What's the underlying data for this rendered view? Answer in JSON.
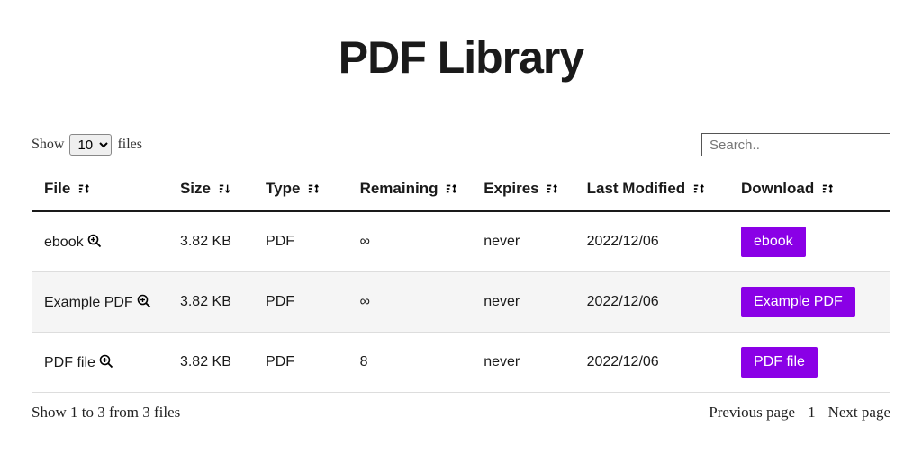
{
  "title": "PDF Library",
  "controls": {
    "show_prefix": "Show",
    "show_value": "10",
    "show_suffix": "files",
    "search_placeholder": "Search.."
  },
  "columns": {
    "file": "File",
    "size": "Size",
    "type": "Type",
    "remaining": "Remaining",
    "expires": "Expires",
    "modified": "Last Modified",
    "download": "Download"
  },
  "rows": [
    {
      "file": "ebook",
      "size": "3.82 KB",
      "type": "PDF",
      "remaining": "∞",
      "expires": "never",
      "modified": "2022/12/06",
      "download": "ebook"
    },
    {
      "file": "Example PDF",
      "size": "3.82 KB",
      "type": "PDF",
      "remaining": "∞",
      "expires": "never",
      "modified": "2022/12/06",
      "download": "Example PDF"
    },
    {
      "file": "PDF file",
      "size": "3.82 KB",
      "type": "PDF",
      "remaining": "8",
      "expires": "never",
      "modified": "2022/12/06",
      "download": "PDF file"
    }
  ],
  "footer": {
    "summary": "Show 1 to 3 from 3 files",
    "prev": "Previous page",
    "page": "1",
    "next": "Next page"
  }
}
